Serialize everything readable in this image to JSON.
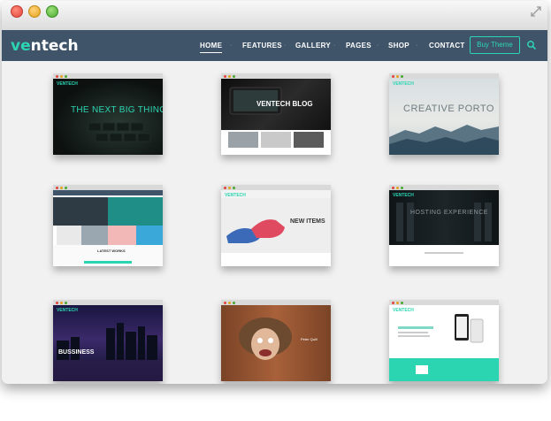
{
  "window": {
    "controls": [
      "close",
      "minimize",
      "maximize"
    ],
    "resize_icon": "resize-arrows-icon"
  },
  "header": {
    "logo": {
      "part1": "ve",
      "part2": "ntech"
    },
    "nav": [
      {
        "label": "HOME",
        "active": true
      },
      {
        "label": "FEATURES",
        "active": false
      },
      {
        "label": "GALLERY",
        "active": false
      },
      {
        "label": "PAGES",
        "active": false
      },
      {
        "label": "SHOP",
        "active": false
      },
      {
        "label": "CONTACT",
        "active": false
      }
    ],
    "buy_button": "Buy Theme",
    "search_icon": "search-icon",
    "separator": "·"
  },
  "demos": [
    {
      "id": "demo-1",
      "headline": "THE NEXT BIG THING",
      "logo": "VENTECH"
    },
    {
      "id": "demo-2",
      "headline": "VENTECH BLOG"
    },
    {
      "id": "demo-3",
      "headline": "CREATIVE PORTO",
      "logo": "VENTECH"
    },
    {
      "id": "demo-4",
      "caption": "LATEST WORKS"
    },
    {
      "id": "demo-5",
      "headline": "NEW ITEMS",
      "logo": "VENTECH"
    },
    {
      "id": "demo-6",
      "headline": "HOSTING EXPERIENCE",
      "logo": "VENTECH"
    },
    {
      "id": "demo-7",
      "headline": "BUSSINESS",
      "logo": "VENTECH"
    },
    {
      "id": "demo-8",
      "caption": "Peter Quill"
    },
    {
      "id": "demo-9",
      "logo": "VENTECH"
    }
  ],
  "colors": {
    "accent": "#2cd5b2",
    "navbar": "#3f5468",
    "background": "#f1f1f1"
  }
}
